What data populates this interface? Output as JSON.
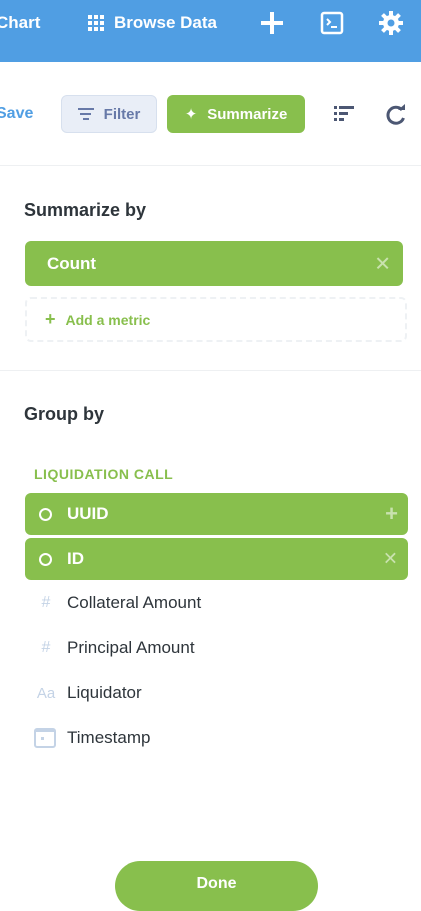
{
  "topbar": {
    "chart_label": "Chart",
    "browse_label": "Browse Data",
    "icons": [
      "plus-icon",
      "terminal-icon",
      "gear-icon"
    ],
    "color": "#509ee3"
  },
  "actionbar": {
    "save_label": "Save",
    "filter_label": "Filter",
    "summarize_label": "Summarize",
    "icons": [
      "list-icon",
      "refresh-icon"
    ]
  },
  "summarize": {
    "title": "Summarize by",
    "metrics": [
      {
        "label": "Count"
      }
    ],
    "add_metric_label": "Add a metric"
  },
  "group_by": {
    "title": "Group by",
    "table_label": "LIQUIDATION CALL",
    "selected": [
      {
        "label": "UUID",
        "action": "add"
      },
      {
        "label": "ID",
        "action": "remove"
      }
    ],
    "fields": [
      {
        "label": "Collateral Amount",
        "type": "number"
      },
      {
        "label": "Principal Amount",
        "type": "number"
      },
      {
        "label": "Liquidator",
        "type": "text"
      },
      {
        "label": "Timestamp",
        "type": "date"
      }
    ]
  },
  "done_label": "Done",
  "colors": {
    "accent_green": "#88bf4d",
    "brand_blue": "#509ee3",
    "filter_purple": "#6779a8"
  }
}
